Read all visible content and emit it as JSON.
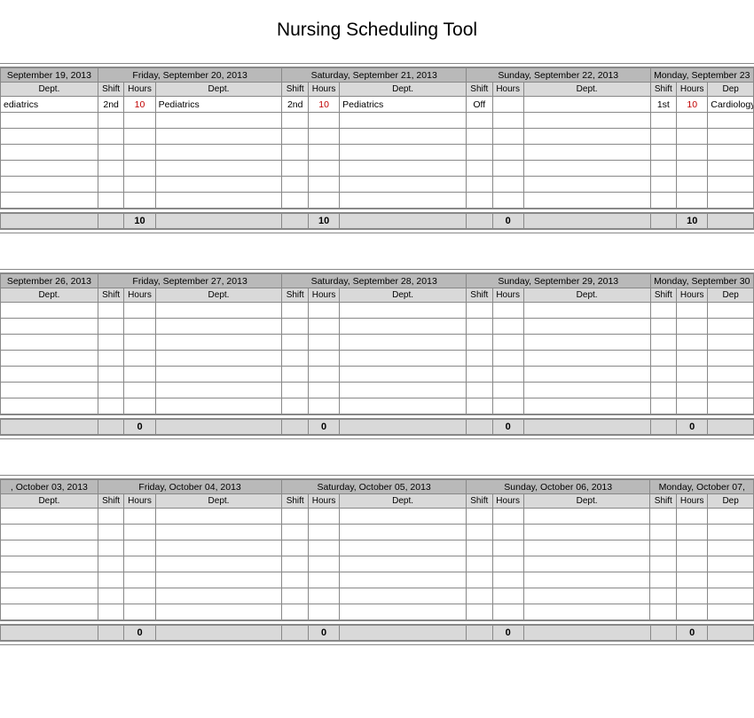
{
  "title": "Nursing Scheduling Tool",
  "labels": {
    "dept_col": "Dept.",
    "shift_col": "Shift",
    "hours_col": "Hours",
    "dept_short": "Dep"
  },
  "weeks": [
    {
      "days": [
        {
          "date": "September 19, 2013"
        },
        {
          "date": "Friday, September 20, 2013"
        },
        {
          "date": "Saturday, September 21, 2013"
        },
        {
          "date": "Sunday, September 22, 2013"
        },
        {
          "date": "Monday, September 23"
        }
      ],
      "rows": [
        {
          "cells": [
            {
              "dept": "ediatrics"
            },
            {
              "shift": "2nd",
              "hours": "10",
              "dept": "Pediatrics"
            },
            {
              "shift": "2nd",
              "hours": "10",
              "dept": "Pediatrics"
            },
            {
              "shift": "Off",
              "hours": "",
              "dept": ""
            },
            {
              "shift": "1st",
              "hours": "10",
              "dept": "Cardiology"
            }
          ]
        },
        {
          "cells": [
            {
              "dept": ""
            },
            {
              "shift": "",
              "hours": "",
              "dept": ""
            },
            {
              "shift": "",
              "hours": "",
              "dept": ""
            },
            {
              "shift": "",
              "hours": "",
              "dept": ""
            },
            {
              "shift": "",
              "hours": "",
              "dept": ""
            }
          ]
        },
        {
          "cells": [
            {
              "dept": ""
            },
            {
              "shift": "",
              "hours": "",
              "dept": ""
            },
            {
              "shift": "",
              "hours": "",
              "dept": ""
            },
            {
              "shift": "",
              "hours": "",
              "dept": ""
            },
            {
              "shift": "",
              "hours": "",
              "dept": ""
            }
          ]
        },
        {
          "cells": [
            {
              "dept": ""
            },
            {
              "shift": "",
              "hours": "",
              "dept": ""
            },
            {
              "shift": "",
              "hours": "",
              "dept": ""
            },
            {
              "shift": "",
              "hours": "",
              "dept": ""
            },
            {
              "shift": "",
              "hours": "",
              "dept": ""
            }
          ]
        },
        {
          "cells": [
            {
              "dept": ""
            },
            {
              "shift": "",
              "hours": "",
              "dept": ""
            },
            {
              "shift": "",
              "hours": "",
              "dept": ""
            },
            {
              "shift": "",
              "hours": "",
              "dept": ""
            },
            {
              "shift": "",
              "hours": "",
              "dept": ""
            }
          ]
        },
        {
          "cells": [
            {
              "dept": ""
            },
            {
              "shift": "",
              "hours": "",
              "dept": ""
            },
            {
              "shift": "",
              "hours": "",
              "dept": ""
            },
            {
              "shift": "",
              "hours": "",
              "dept": ""
            },
            {
              "shift": "",
              "hours": "",
              "dept": ""
            }
          ]
        },
        {
          "cells": [
            {
              "dept": ""
            },
            {
              "shift": "",
              "hours": "",
              "dept": ""
            },
            {
              "shift": "",
              "hours": "",
              "dept": ""
            },
            {
              "shift": "",
              "hours": "",
              "dept": ""
            },
            {
              "shift": "",
              "hours": "",
              "dept": ""
            }
          ]
        }
      ],
      "totals": [
        "",
        "10",
        "10",
        "0",
        "10"
      ]
    },
    {
      "days": [
        {
          "date": "September 26, 2013"
        },
        {
          "date": "Friday, September 27, 2013"
        },
        {
          "date": "Saturday, September 28, 2013"
        },
        {
          "date": "Sunday, September 29, 2013"
        },
        {
          "date": "Monday, September 30"
        }
      ],
      "rows": [
        {
          "cells": [
            {
              "dept": ""
            },
            {
              "shift": "",
              "hours": "",
              "dept": ""
            },
            {
              "shift": "",
              "hours": "",
              "dept": ""
            },
            {
              "shift": "",
              "hours": "",
              "dept": ""
            },
            {
              "shift": "",
              "hours": "",
              "dept": ""
            }
          ]
        },
        {
          "cells": [
            {
              "dept": ""
            },
            {
              "shift": "",
              "hours": "",
              "dept": ""
            },
            {
              "shift": "",
              "hours": "",
              "dept": ""
            },
            {
              "shift": "",
              "hours": "",
              "dept": ""
            },
            {
              "shift": "",
              "hours": "",
              "dept": ""
            }
          ]
        },
        {
          "cells": [
            {
              "dept": ""
            },
            {
              "shift": "",
              "hours": "",
              "dept": ""
            },
            {
              "shift": "",
              "hours": "",
              "dept": ""
            },
            {
              "shift": "",
              "hours": "",
              "dept": ""
            },
            {
              "shift": "",
              "hours": "",
              "dept": ""
            }
          ]
        },
        {
          "cells": [
            {
              "dept": ""
            },
            {
              "shift": "",
              "hours": "",
              "dept": ""
            },
            {
              "shift": "",
              "hours": "",
              "dept": ""
            },
            {
              "shift": "",
              "hours": "",
              "dept": ""
            },
            {
              "shift": "",
              "hours": "",
              "dept": ""
            }
          ]
        },
        {
          "cells": [
            {
              "dept": ""
            },
            {
              "shift": "",
              "hours": "",
              "dept": ""
            },
            {
              "shift": "",
              "hours": "",
              "dept": ""
            },
            {
              "shift": "",
              "hours": "",
              "dept": ""
            },
            {
              "shift": "",
              "hours": "",
              "dept": ""
            }
          ]
        },
        {
          "cells": [
            {
              "dept": ""
            },
            {
              "shift": "",
              "hours": "",
              "dept": ""
            },
            {
              "shift": "",
              "hours": "",
              "dept": ""
            },
            {
              "shift": "",
              "hours": "",
              "dept": ""
            },
            {
              "shift": "",
              "hours": "",
              "dept": ""
            }
          ]
        },
        {
          "cells": [
            {
              "dept": ""
            },
            {
              "shift": "",
              "hours": "",
              "dept": ""
            },
            {
              "shift": "",
              "hours": "",
              "dept": ""
            },
            {
              "shift": "",
              "hours": "",
              "dept": ""
            },
            {
              "shift": "",
              "hours": "",
              "dept": ""
            }
          ]
        }
      ],
      "totals": [
        "",
        "0",
        "0",
        "0",
        "0"
      ]
    },
    {
      "days": [
        {
          "date": ", October 03, 2013"
        },
        {
          "date": "Friday, October 04, 2013"
        },
        {
          "date": "Saturday, October 05, 2013"
        },
        {
          "date": "Sunday, October 06, 2013"
        },
        {
          "date": "Monday, October 07,"
        }
      ],
      "rows": [
        {
          "cells": [
            {
              "dept": ""
            },
            {
              "shift": "",
              "hours": "",
              "dept": ""
            },
            {
              "shift": "",
              "hours": "",
              "dept": ""
            },
            {
              "shift": "",
              "hours": "",
              "dept": ""
            },
            {
              "shift": "",
              "hours": "",
              "dept": ""
            }
          ]
        },
        {
          "cells": [
            {
              "dept": ""
            },
            {
              "shift": "",
              "hours": "",
              "dept": ""
            },
            {
              "shift": "",
              "hours": "",
              "dept": ""
            },
            {
              "shift": "",
              "hours": "",
              "dept": ""
            },
            {
              "shift": "",
              "hours": "",
              "dept": ""
            }
          ]
        },
        {
          "cells": [
            {
              "dept": ""
            },
            {
              "shift": "",
              "hours": "",
              "dept": ""
            },
            {
              "shift": "",
              "hours": "",
              "dept": ""
            },
            {
              "shift": "",
              "hours": "",
              "dept": ""
            },
            {
              "shift": "",
              "hours": "",
              "dept": ""
            }
          ]
        },
        {
          "cells": [
            {
              "dept": ""
            },
            {
              "shift": "",
              "hours": "",
              "dept": ""
            },
            {
              "shift": "",
              "hours": "",
              "dept": ""
            },
            {
              "shift": "",
              "hours": "",
              "dept": ""
            },
            {
              "shift": "",
              "hours": "",
              "dept": ""
            }
          ]
        },
        {
          "cells": [
            {
              "dept": ""
            },
            {
              "shift": "",
              "hours": "",
              "dept": ""
            },
            {
              "shift": "",
              "hours": "",
              "dept": ""
            },
            {
              "shift": "",
              "hours": "",
              "dept": ""
            },
            {
              "shift": "",
              "hours": "",
              "dept": ""
            }
          ]
        },
        {
          "cells": [
            {
              "dept": ""
            },
            {
              "shift": "",
              "hours": "",
              "dept": ""
            },
            {
              "shift": "",
              "hours": "",
              "dept": ""
            },
            {
              "shift": "",
              "hours": "",
              "dept": ""
            },
            {
              "shift": "",
              "hours": "",
              "dept": ""
            }
          ]
        },
        {
          "cells": [
            {
              "dept": ""
            },
            {
              "shift": "",
              "hours": "",
              "dept": ""
            },
            {
              "shift": "",
              "hours": "",
              "dept": ""
            },
            {
              "shift": "",
              "hours": "",
              "dept": ""
            },
            {
              "shift": "",
              "hours": "",
              "dept": ""
            }
          ]
        }
      ],
      "totals": [
        "",
        "0",
        "0",
        "0",
        "0"
      ]
    }
  ]
}
